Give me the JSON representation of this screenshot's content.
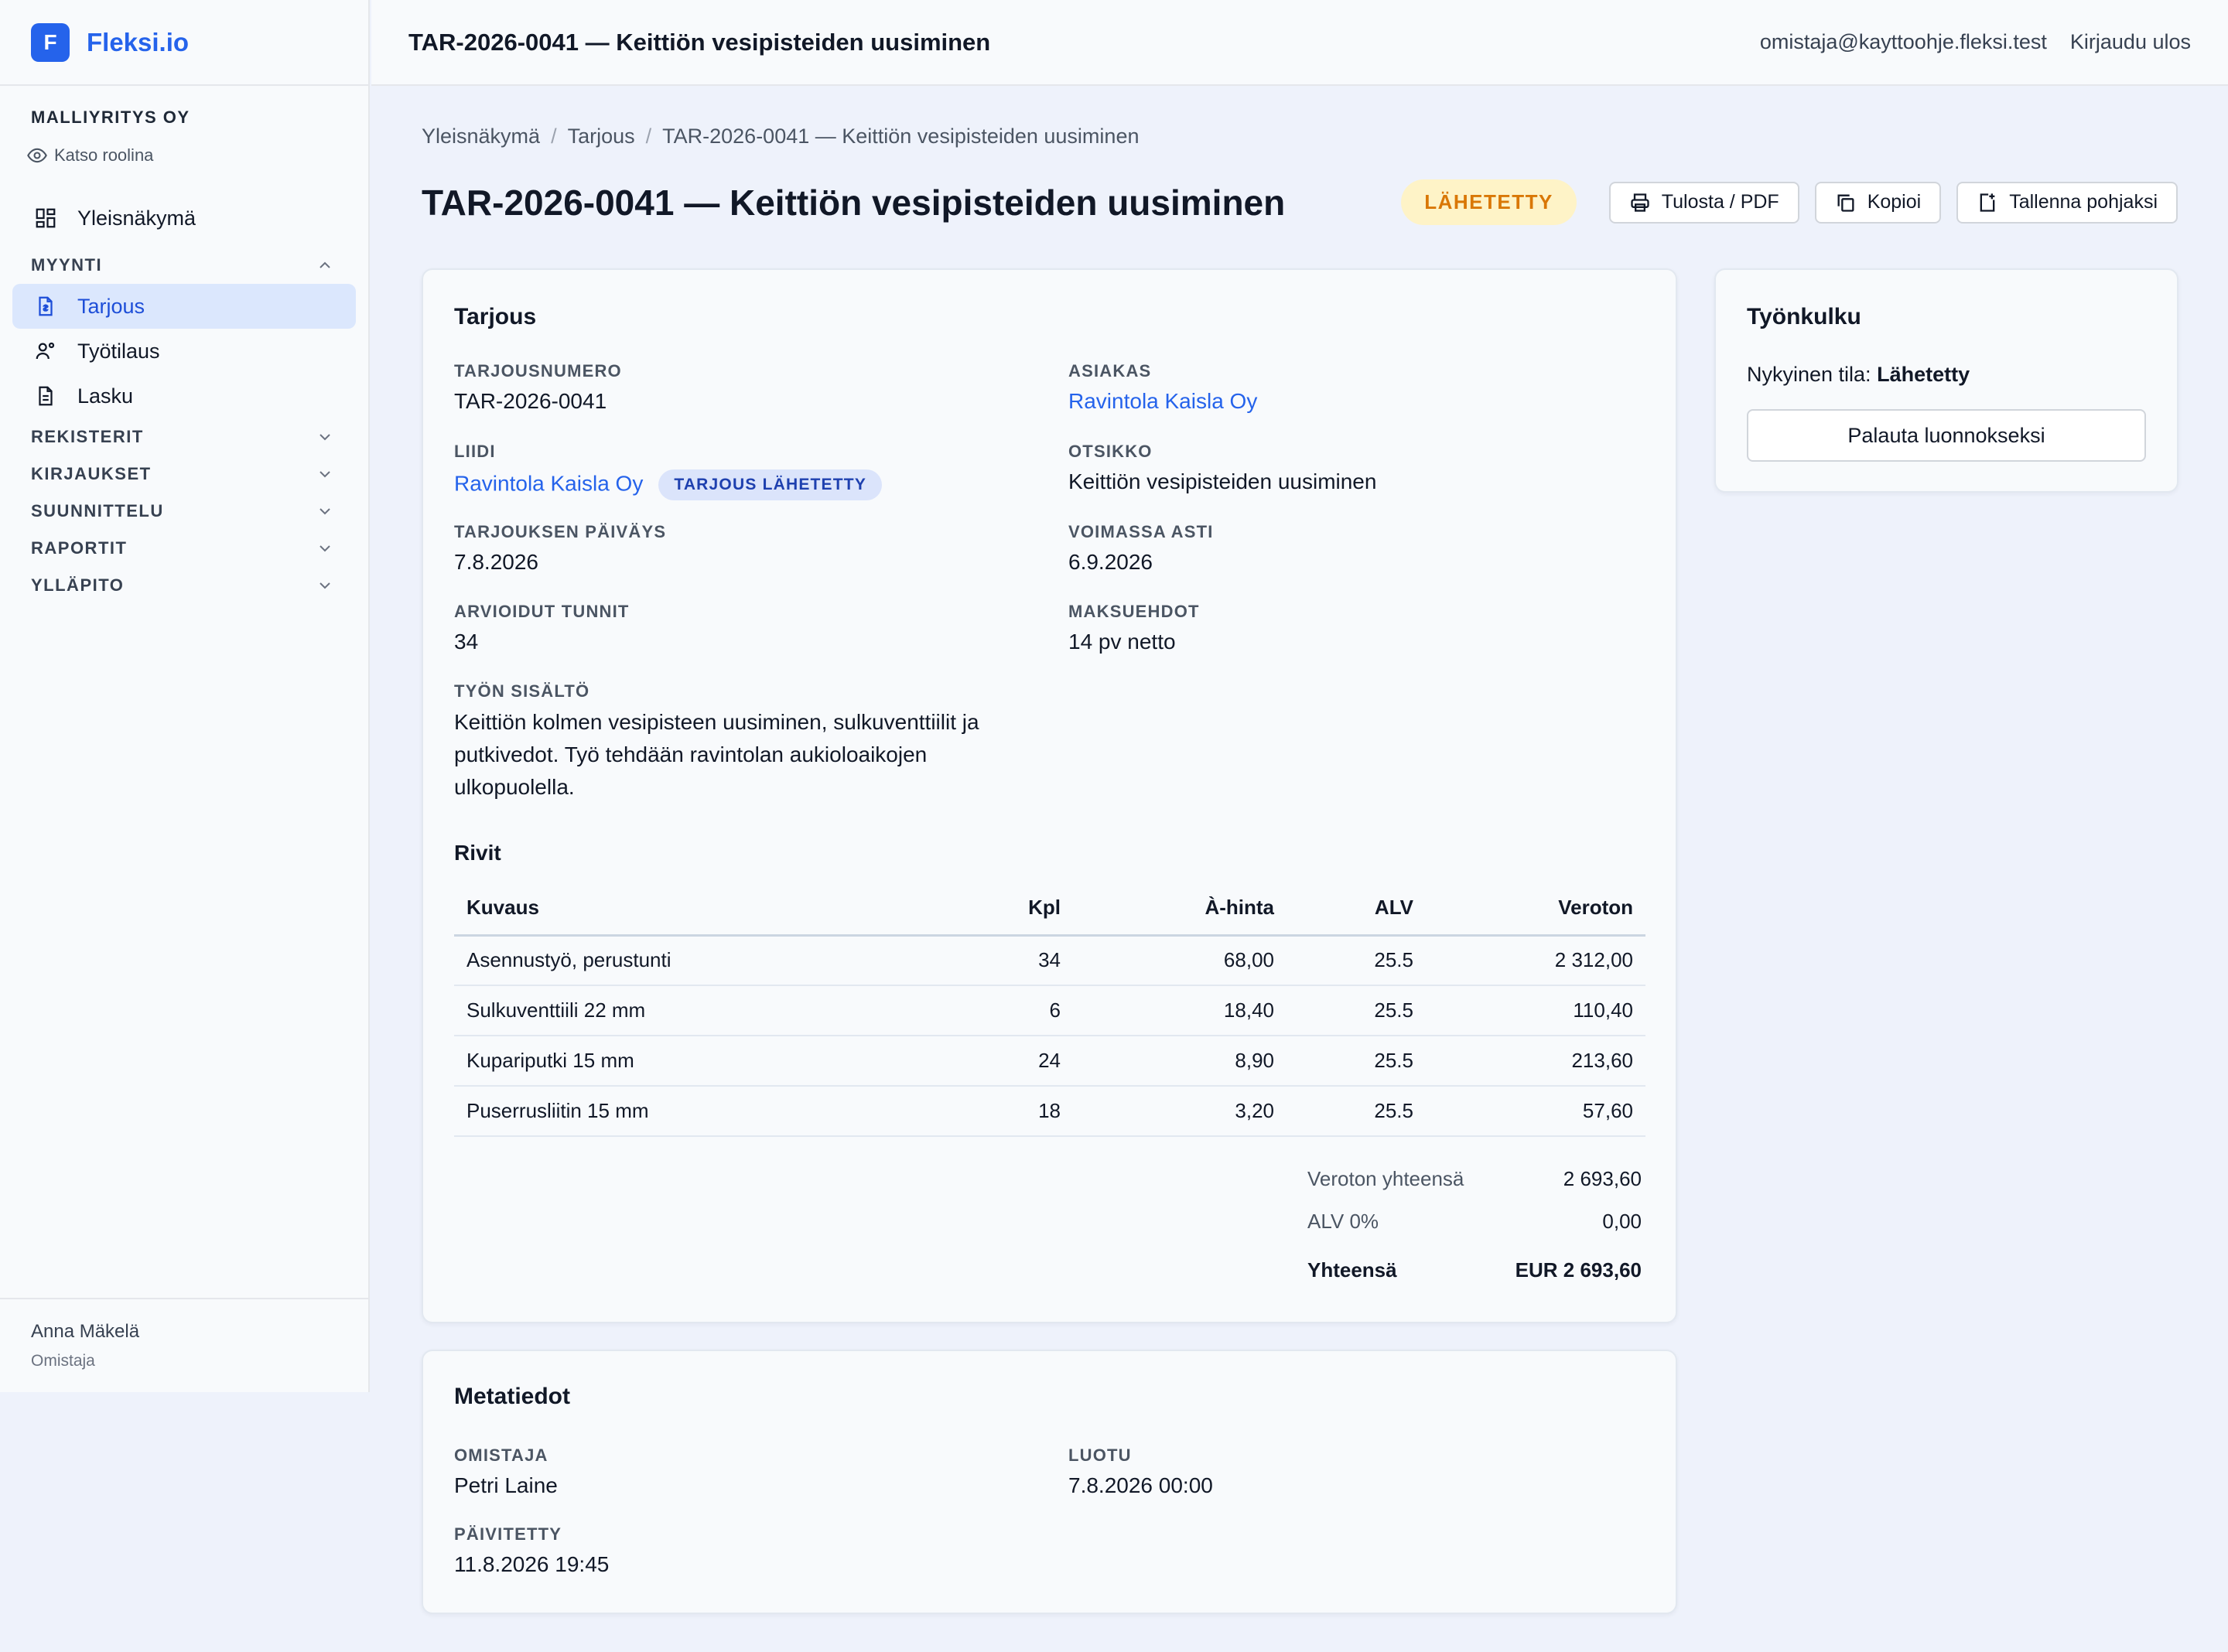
{
  "brand": {
    "logo_letter": "F",
    "name": "Fleksi.io",
    "color": "#2563eb"
  },
  "sidebar": {
    "company": "MALLIYRITYS OY",
    "view_role": "Katso roolina",
    "overview": "Yleisnäkymä",
    "sales_section": "MYYNTI",
    "sales_items": [
      "Tarjous",
      "Työtilaus",
      "Lasku"
    ],
    "active_item": "Tarjous",
    "sections": [
      "REKISTERIT",
      "KIRJAUKSET",
      "SUUNNITTELU",
      "RAPORTIT",
      "YLLÄPITO"
    ],
    "user_name": "Anna Mäkelä",
    "user_role": "Omistaja"
  },
  "topbar": {
    "title": "TAR-2026-0041 — Keittiön vesipisteiden uusiminen",
    "email": "omistaja@kayttoohje.fleksi.test",
    "logout": "Kirjaudu ulos"
  },
  "breadcrumb": [
    "Yleisnäkymä",
    "Tarjous",
    "TAR-2026-0041 — Keittiön vesipisteiden uusiminen"
  ],
  "page": {
    "title": "TAR-2026-0041 — Keittiön vesipisteiden uusiminen",
    "status": "LÄHETETTY",
    "status_color": "#d97706",
    "actions": {
      "print": "Tulosta / PDF",
      "copy": "Kopioi",
      "save_template": "Tallenna pohjaksi"
    }
  },
  "offer": {
    "card_title": "Tarjous",
    "number_label": "TARJOUSNUMERO",
    "number": "TAR-2026-0041",
    "customer_label": "ASIAKAS",
    "customer": "Ravintola Kaisla Oy",
    "lead_label": "LIIDI",
    "lead": "Ravintola Kaisla Oy",
    "lead_badge": "TARJOUS LÄHETETTY",
    "subject_label": "OTSIKKO",
    "subject": "Keittiön vesipisteiden uusiminen",
    "date_label": "TARJOUKSEN PÄIVÄYS",
    "date": "7.8.2026",
    "valid_label": "VOIMASSA ASTI",
    "valid": "6.9.2026",
    "hours_label": "ARVIOIDUT TUNNIT",
    "hours": "34",
    "terms_label": "MAKSUEHDOT",
    "terms": "14 pv netto",
    "content_label": "TYÖN SISÄLTÖ",
    "content": "Keittiön kolmen vesipisteen uusiminen, sulkuventtiilit ja putkivedot. Työ tehdään ravintolan aukioloaikojen ulkopuolella.",
    "rows_title": "Rivit",
    "columns": [
      "Kuvaus",
      "Kpl",
      "À-hinta",
      "ALV",
      "Veroton"
    ],
    "rows": [
      [
        "Asennustyö, perustunti",
        "34",
        "68,00",
        "25.5",
        "2 312,00"
      ],
      [
        "Sulkuventtiili 22 mm",
        "6",
        "18,40",
        "25.5",
        "110,40"
      ],
      [
        "Kupariputki 15 mm",
        "24",
        "8,90",
        "25.5",
        "213,60"
      ],
      [
        "Puserrusliitin 15 mm",
        "18",
        "3,20",
        "25.5",
        "57,60"
      ]
    ],
    "net_total_label": "Veroton yhteensä",
    "net_total": "2 693,60",
    "vat_label": "ALV 0%",
    "vat": "0,00",
    "grand_label": "Yhteensä",
    "grand": "EUR 2 693,60"
  },
  "workflow": {
    "title": "Työnkulku",
    "state_label": "Nykyinen tila:",
    "state": "Lähetetty",
    "revert_button": "Palauta luonnokseksi"
  },
  "meta": {
    "title": "Metatiedot",
    "owner_label": "OMISTAJA",
    "owner": "Petri Laine",
    "created_label": "LUOTU",
    "created": "7.8.2026 00:00",
    "updated_label": "PÄIVITETTY",
    "updated": "11.8.2026 19:45"
  }
}
